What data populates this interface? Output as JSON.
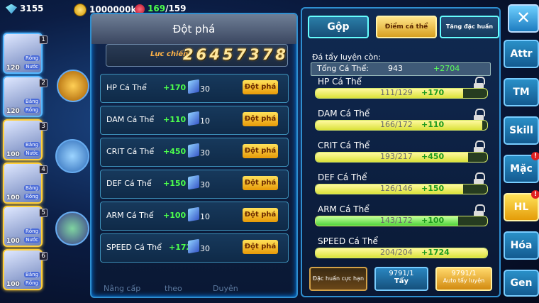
{
  "resources": {
    "gems": "3155",
    "gold": "1000000k",
    "stamina_current": "169",
    "stamina_max": "/159"
  },
  "team": [
    {
      "level": "120",
      "tags": [
        "Rồng",
        "Nước"
      ],
      "slot": "1"
    },
    {
      "level": "120",
      "tags": [
        "Bằng",
        "Rồng"
      ],
      "slot": "2"
    },
    {
      "level": "100",
      "tags": [
        "Bằng",
        "Nước"
      ],
      "slot": "3"
    },
    {
      "level": "100",
      "tags": [
        "Bằng",
        "Rồng"
      ],
      "slot": "4"
    },
    {
      "level": "100",
      "tags": [
        "Rồng",
        "Nước"
      ],
      "slot": "5"
    },
    {
      "level": "100",
      "tags": [
        "Bằng",
        "Rồng"
      ],
      "slot": "6"
    }
  ],
  "left_panel": {
    "title": "Đột phá",
    "power_label": "Lực chiến",
    "power_value": "26457378",
    "rows": [
      {
        "name": "HP Cá Thể",
        "plus": "+170",
        "cost": "30",
        "button": "Đột phá"
      },
      {
        "name": "DAM Cá Thể",
        "plus": "+110",
        "cost": "10",
        "button": "Đột phá"
      },
      {
        "name": "CRIT Cá Thể",
        "plus": "+450",
        "cost": "30",
        "button": "Đột phá"
      },
      {
        "name": "DEF Cá Thể",
        "plus": "+150",
        "cost": "30",
        "button": "Đột phá"
      },
      {
        "name": "ARM Cá Thể",
        "plus": "+100",
        "cost": "10",
        "button": "Đột phá"
      },
      {
        "name": "SPEED Cá Thể",
        "plus": "+1724",
        "cost": "30",
        "button": "Đột phá"
      }
    ]
  },
  "bottom_labels": [
    "Nâng cấp",
    "theo",
    "Duyên"
  ],
  "right_panel": {
    "tabs": [
      "Gộp",
      "Điểm cá thể",
      "Tăng đặc huấn"
    ],
    "remaining_label": "Đá tẩy luyện còn:",
    "total_label": "Tổng Cá Thể:",
    "total_value": "943",
    "total_bonus": "+2704",
    "stats": [
      {
        "name": "HP Cá Thể",
        "value": "111/129",
        "bonus": "+170",
        "fill": 0.86,
        "color": "yellow"
      },
      {
        "name": "DAM Cá Thể",
        "value": "166/172",
        "bonus": "+110",
        "fill": 0.97,
        "color": "yellow"
      },
      {
        "name": "CRIT Cá Thể",
        "value": "193/217",
        "bonus": "+450",
        "fill": 0.89,
        "color": "yellow"
      },
      {
        "name": "DEF Cá Thể",
        "value": "126/146",
        "bonus": "+150",
        "fill": 0.86,
        "color": "yellow"
      },
      {
        "name": "ARM Cá Thể",
        "value": "143/172",
        "bonus": "+100",
        "fill": 0.83,
        "color": "green"
      },
      {
        "name": "SPEED Cá Thể",
        "value": "204/204",
        "bonus": "+1724",
        "fill": 1.0,
        "color": "yellow"
      }
    ],
    "buttons": {
      "special_label": "Đặc huấn cực hạn",
      "wash_count": "9791/1",
      "wash_label": "Tẩy",
      "auto_count": "9791/1",
      "auto_label": "Auto tẩy luyện"
    }
  },
  "side_tabs": [
    {
      "label": "Attr",
      "badge": ""
    },
    {
      "label": "TM",
      "badge": ""
    },
    {
      "label": "Skill",
      "badge": ""
    },
    {
      "label": "Mặc",
      "badge": "!"
    },
    {
      "label": "HL",
      "badge": "!",
      "active": true
    },
    {
      "label": "Hóa",
      "badge": ""
    },
    {
      "label": "Gen",
      "badge": ""
    }
  ],
  "close_label": "✕"
}
